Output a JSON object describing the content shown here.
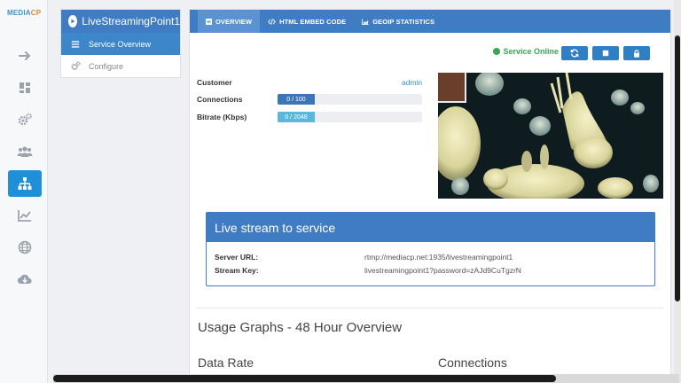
{
  "brand": {
    "name_main": "MEDIA",
    "name_accent": "CP"
  },
  "rail": [
    "arrow-right-icon",
    "dashboard-icon",
    "gears-icon",
    "users-icon",
    "sitemap-icon",
    "chart-icon",
    "globe-icon",
    "cloud-download-icon"
  ],
  "menu": {
    "title": "LiveStreamingPoint1",
    "items": [
      {
        "label": "Service Overview",
        "icon": "bars-icon",
        "active": true
      },
      {
        "label": "Configure",
        "icon": "gears-icon",
        "active": false
      }
    ]
  },
  "tabs": [
    {
      "label": "OVERVIEW",
      "active": true
    },
    {
      "label": "HTML EMBED CODE",
      "active": false
    },
    {
      "label": "GEOIP STATISTICS",
      "active": false
    }
  ],
  "status": {
    "label": "Service Online",
    "color": "#3aa655"
  },
  "controls": [
    "refresh-icon",
    "stop-icon",
    "lock-icon"
  ],
  "overview": {
    "customer_label": "Customer",
    "customer_value": "admin",
    "connections_label": "Connections",
    "connections_value": "0 / 100",
    "connections_fraction": 0,
    "bitrate_label": "Bitrate (Kbps)",
    "bitrate_value": "0 / 2048",
    "bitrate_fraction": 0
  },
  "live": {
    "title": "Live stream to service",
    "server_label": "Server URL:",
    "server_value": "rtmp://mediacp.net:1935/livestreamingpoint1",
    "key_label": "Stream Key:",
    "key_value": "livestreamingpoint1?password=zAJd9CuTgzrN"
  },
  "usage": {
    "title": "Usage Graphs - 48 Hour Overview",
    "data_rate": "Data Rate",
    "connections": "Connections"
  },
  "colors": {
    "accent": "#3f7cc4",
    "rail_active": "#1f8fd8"
  }
}
